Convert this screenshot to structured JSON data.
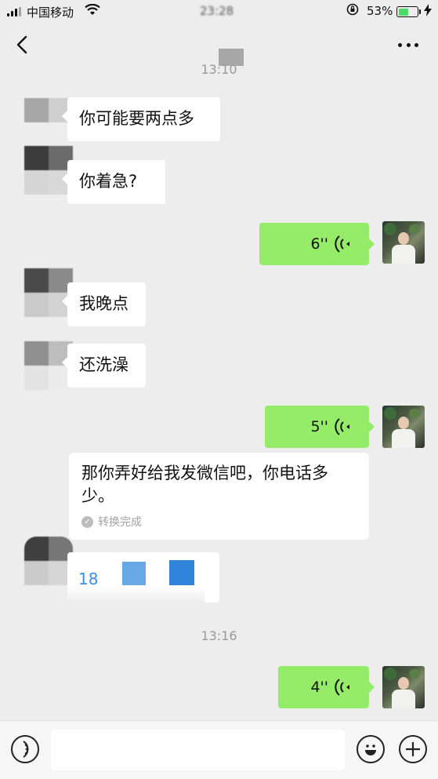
{
  "status_bar": {
    "carrier": "中国移动",
    "time": "23:28",
    "battery_percent": "53%",
    "battery_level": 0.53,
    "icons": [
      "signal-icon",
      "wifi-icon",
      "orientation-lock-icon",
      "battery-icon",
      "charging-icon"
    ]
  },
  "nav": {
    "back_icon": "chevron-left-icon",
    "more_icon": "ellipsis-icon"
  },
  "chat": {
    "timestamps": [
      "13:10",
      "13:16"
    ],
    "messages": [
      {
        "side": "left",
        "type": "text",
        "text": "你可能要两点多"
      },
      {
        "side": "left",
        "type": "text",
        "text": "你着急?"
      },
      {
        "side": "right",
        "type": "voice",
        "duration": "6''"
      },
      {
        "side": "left",
        "type": "text",
        "text": "我晚点"
      },
      {
        "side": "left",
        "type": "text",
        "text": "还洗澡"
      },
      {
        "side": "right",
        "type": "voice",
        "duration": "5''"
      },
      {
        "side": "right",
        "type": "transcript",
        "text": "那你弄好给我发微信吧，你电话多少。",
        "status": "转换完成"
      },
      {
        "side": "left",
        "type": "partial",
        "text": "18"
      },
      {
        "side": "right",
        "type": "voice",
        "duration": "4''"
      }
    ]
  },
  "input_bar": {
    "voice_icon": "voice-mode-icon",
    "emoji_icon": "emoji-icon",
    "plus_icon": "plus-icon",
    "input_value": "",
    "input_placeholder": ""
  },
  "colors": {
    "background": "#ededed",
    "sent_bubble": "#95ec69",
    "received_bubble": "#ffffff",
    "timestamp_text": "#999999"
  }
}
